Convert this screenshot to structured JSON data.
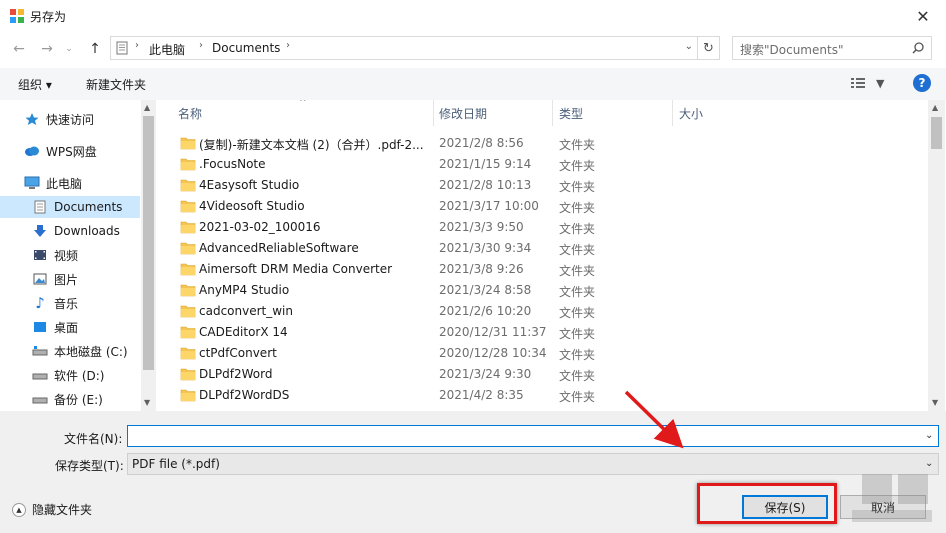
{
  "window": {
    "title": "另存为",
    "close_glyph": "✕"
  },
  "address": {
    "breadcrumbs": [
      "此电脑",
      "Documents"
    ],
    "search_placeholder": "搜索\"Documents\""
  },
  "toolbar": {
    "organize": "组织 ▾",
    "new_folder": "新建文件夹",
    "help": "?"
  },
  "nav": {
    "items": [
      {
        "label": "快速访问",
        "icon": "star-icon"
      },
      {
        "label": "WPS网盘",
        "icon": "cloud-icon"
      },
      {
        "label": "此电脑",
        "icon": "computer-icon"
      },
      {
        "label": "Documents",
        "icon": "document-icon",
        "selected": true
      },
      {
        "label": "Downloads",
        "icon": "download-icon"
      },
      {
        "label": "视频",
        "icon": "video-icon"
      },
      {
        "label": "图片",
        "icon": "picture-icon"
      },
      {
        "label": "音乐",
        "icon": "music-icon"
      },
      {
        "label": "桌面",
        "icon": "desktop-icon"
      },
      {
        "label": "本地磁盘 (C:)",
        "icon": "drive-icon"
      },
      {
        "label": "软件 (D:)",
        "icon": "drive-icon"
      },
      {
        "label": "备份 (E:)",
        "icon": "drive-icon"
      }
    ]
  },
  "columns": {
    "name": "名称",
    "date": "修改日期",
    "type": "类型",
    "size": "大小"
  },
  "files": [
    {
      "name": "(复制)-新建文本文档 (2)（合并）.pdf-2...",
      "date": "2021/2/8 8:56",
      "type": "文件夹"
    },
    {
      "name": ".FocusNote",
      "date": "2021/1/15 9:14",
      "type": "文件夹"
    },
    {
      "name": "4Easysoft Studio",
      "date": "2021/2/8 10:13",
      "type": "文件夹"
    },
    {
      "name": "4Videosoft Studio",
      "date": "2021/3/17 10:00",
      "type": "文件夹"
    },
    {
      "name": "2021-03-02_100016",
      "date": "2021/3/3 9:50",
      "type": "文件夹"
    },
    {
      "name": "AdvancedReliableSoftware",
      "date": "2021/3/30 9:34",
      "type": "文件夹"
    },
    {
      "name": "Aimersoft DRM Media Converter",
      "date": "2021/3/8 9:26",
      "type": "文件夹"
    },
    {
      "name": "AnyMP4 Studio",
      "date": "2021/3/24 8:58",
      "type": "文件夹"
    },
    {
      "name": "cadconvert_win",
      "date": "2021/2/6 10:20",
      "type": "文件夹"
    },
    {
      "name": "CADEditorX 14",
      "date": "2020/12/31 11:37",
      "type": "文件夹"
    },
    {
      "name": "ctPdfConvert",
      "date": "2020/12/28 10:34",
      "type": "文件夹"
    },
    {
      "name": "DLPdf2Word",
      "date": "2021/3/24 9:30",
      "type": "文件夹"
    },
    {
      "name": "DLPdf2WordDS",
      "date": "2021/4/2 8:35",
      "type": "文件夹"
    }
  ],
  "form": {
    "filename_label": "文件名(N):",
    "filename_value": "",
    "filetype_label": "保存类型(T):",
    "filetype_value": "PDF file (*.pdf)"
  },
  "buttons": {
    "hide_folders": "隐藏文件夹",
    "save": "保存(S)",
    "cancel": "取消"
  },
  "colors": {
    "accent": "#0078d7",
    "selected_bg": "#cce8ff",
    "folder": "#f5c451",
    "annotation": "#e01a1a"
  }
}
